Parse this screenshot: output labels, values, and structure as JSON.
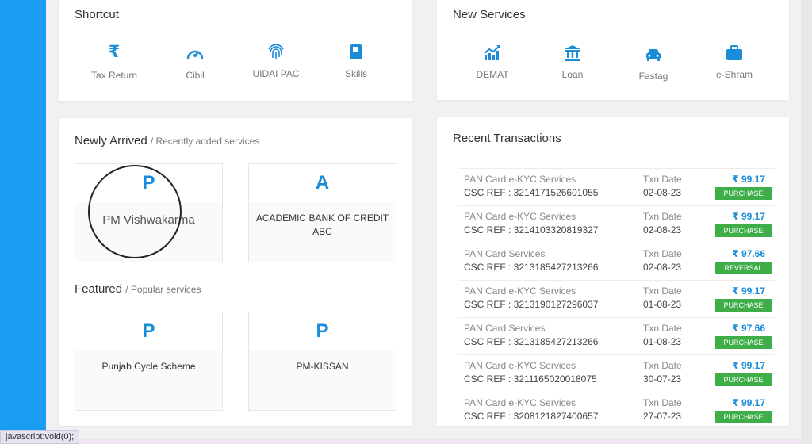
{
  "shortcut": {
    "title": "Shortcut",
    "items": [
      {
        "label": "Tax Return",
        "icon": "rupee-icon"
      },
      {
        "label": "Cibil",
        "icon": "gauge-icon"
      },
      {
        "label": "UIDAI PAC",
        "icon": "fingerprint-icon"
      },
      {
        "label": "Skills",
        "icon": "book-icon"
      }
    ]
  },
  "new_services": {
    "title": "New Services",
    "items": [
      {
        "label": "DEMAT",
        "icon": "chart-up-icon"
      },
      {
        "label": "Loan",
        "icon": "bank-icon"
      },
      {
        "label": "Fastag",
        "icon": "car-icon"
      },
      {
        "label": "e-Shram",
        "icon": "briefcase-icon"
      }
    ]
  },
  "newly_arrived": {
    "title": "Newly Arrived",
    "subtitle": "/ Recently added services",
    "tiles": [
      {
        "letter": "P",
        "name": "PM Vishwakarma"
      },
      {
        "letter": "A",
        "name": "ACADEMIC BANK OF CREDIT ABC"
      }
    ]
  },
  "featured": {
    "title": "Featured",
    "subtitle": "/ Popular services",
    "tiles": [
      {
        "letter": "P",
        "name": "Punjab Cycle Scheme"
      },
      {
        "letter": "P",
        "name": "PM-KISSAN"
      }
    ]
  },
  "recent": {
    "title": "Recent Transactions",
    "rows": [
      {
        "service": "PAN Card e-KYC Services",
        "ref": "CSC REF : 3214171526601055",
        "date_label": "Txn Date",
        "date": "02-08-23",
        "amount": "₹ 99.17",
        "status": "PURCHASE"
      },
      {
        "service": "PAN Card e-KYC Services",
        "ref": "CSC REF : 3214103320819327",
        "date_label": "Txn Date",
        "date": "02-08-23",
        "amount": "₹ 99.17",
        "status": "PURCHASE"
      },
      {
        "service": "PAN Card Services",
        "ref": "CSC REF : 3213185427213266",
        "date_label": "Txn Date",
        "date": "02-08-23",
        "amount": "₹ 97.66",
        "status": "REVERSAL"
      },
      {
        "service": "PAN Card e-KYC Services",
        "ref": "CSC REF : 3213190127296037",
        "date_label": "Txn Date",
        "date": "01-08-23",
        "amount": "₹ 99.17",
        "status": "PURCHASE"
      },
      {
        "service": "PAN Card Services",
        "ref": "CSC REF : 3213185427213266",
        "date_label": "Txn Date",
        "date": "01-08-23",
        "amount": "₹ 97.66",
        "status": "PURCHASE"
      },
      {
        "service": "PAN Card e-KYC Services",
        "ref": "CSC REF : 3211165020018075",
        "date_label": "Txn Date",
        "date": "30-07-23",
        "amount": "₹ 99.17",
        "status": "PURCHASE"
      },
      {
        "service": "PAN Card e-KYC Services",
        "ref": "CSC REF : 3208121827400657",
        "date_label": "Txn Date",
        "date": "27-07-23",
        "amount": "₹ 99.17",
        "status": "PURCHASE"
      }
    ]
  },
  "status_bar": {
    "url": "javascript:void(0);"
  },
  "colors": {
    "accent": "#1a8cd8",
    "sidebar": "#1a9cf2",
    "purchase": "#3fae49",
    "reversal": "#3fae49"
  }
}
